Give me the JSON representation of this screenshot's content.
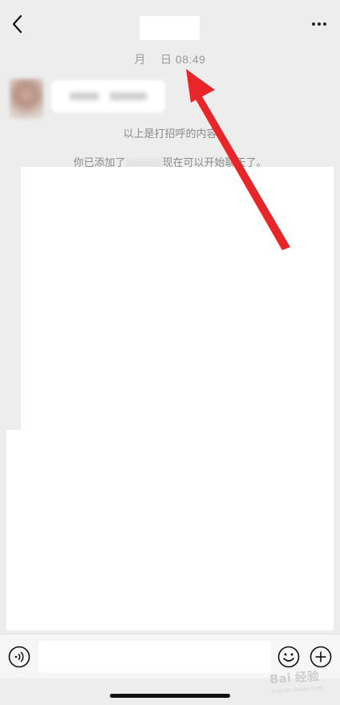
{
  "nav": {
    "back_icon": "chevron-left-icon",
    "more_icon": "more-dots-icon",
    "title": ""
  },
  "chat": {
    "timestamp_month": "月",
    "timestamp_day_time": "日 08:49",
    "system_greeting_note": "以上是打招呼的内容",
    "system_added_prefix": "你已添加了",
    "system_added_suffix": "现在可以开始聊天了。"
  },
  "input_bar": {
    "voice_icon": "voice-icon",
    "emoji_icon": "emoji-icon",
    "plus_icon": "plus-icon",
    "placeholder": ""
  },
  "annotation": {
    "arrow_color": "#e8262a"
  },
  "watermark": {
    "text": "Bai 经验",
    "sub": "jingyan.baidu.com"
  }
}
